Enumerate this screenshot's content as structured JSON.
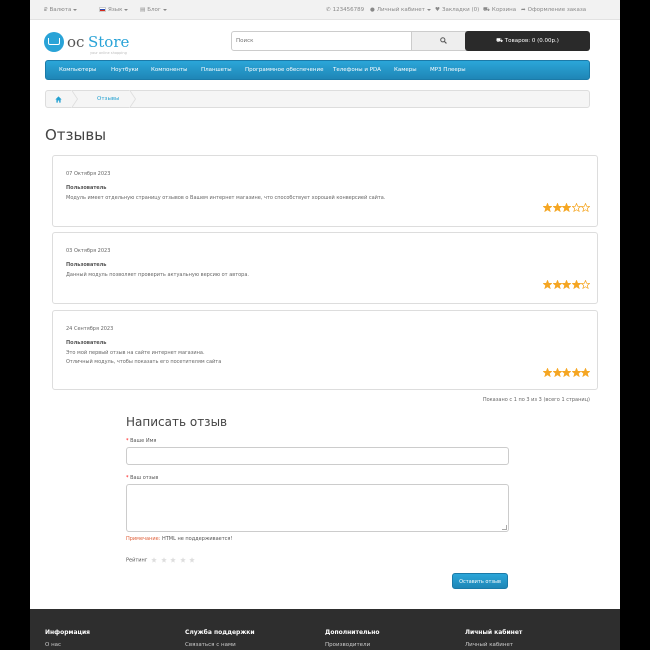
{
  "topbar": {
    "currency": "Валюта",
    "language": "Язык",
    "blog": "Блог",
    "phone": "123456789",
    "account": "Личный кабинет",
    "wishlist": "Закладки (0)",
    "cart": "Корзина",
    "checkout": "Оформление заказа"
  },
  "header": {
    "logo_oc": "oc",
    "logo_store": "Store",
    "logo_tagline": "your online shopping",
    "search_placeholder": "Поиск",
    "cart_label": "Товаров: 0 (0.00р.)"
  },
  "menu": {
    "items": [
      "Компьютеры",
      "Ноутбуки",
      "Компоненты",
      "Планшеты",
      "Программное обеспечение",
      "Телефоны и PDA",
      "Камеры",
      "MP3 Плееры"
    ]
  },
  "breadcrumb": {
    "current": "Отзывы"
  },
  "page_title": "Отзывы",
  "reviews": [
    {
      "date": "07 Октября 2023",
      "author": "Пользователь",
      "text": "Модуль имеет отдельную страницу отзывов о Вашем интернет магазине, что способствует хорошей конверсией сайта.",
      "rating": 3
    },
    {
      "date": "03 Октября 2023",
      "author": "Пользователь",
      "text": "Данный модуль позволяет проверить актуальную версию от автора.",
      "rating": 4
    },
    {
      "date": "24 Сентября 2023",
      "author": "Пользователь",
      "text": "Это мой первый отзыв на сайте интернет магазина.\nОтличный модуль, чтобы показать его посетителям сайта",
      "rating": 5
    }
  ],
  "pagination_text": "Показано с 1 по 3 из 3 (всего 1 страниц)",
  "form": {
    "title": "Написать отзыв",
    "name_label": "Ваше Имя",
    "review_label": "Ваш отзыв",
    "note_warning": "Примечание:",
    "note_text": "HTML не поддерживается!",
    "rating_label": "Рейтинг",
    "submit_label": "Оставить отзыв"
  },
  "footer": {
    "columns": [
      {
        "head": "Информация",
        "link": "О нас"
      },
      {
        "head": "Служба поддержки",
        "link": "Связаться с нами"
      },
      {
        "head": "Дополнительно",
        "link": "Производители"
      },
      {
        "head": "Личный кабинет",
        "link": "Личный кабинет"
      }
    ]
  },
  "colors": {
    "accent": "#23a1d1",
    "star": "#f5a623",
    "footer_bg": "#2e2e2e"
  }
}
